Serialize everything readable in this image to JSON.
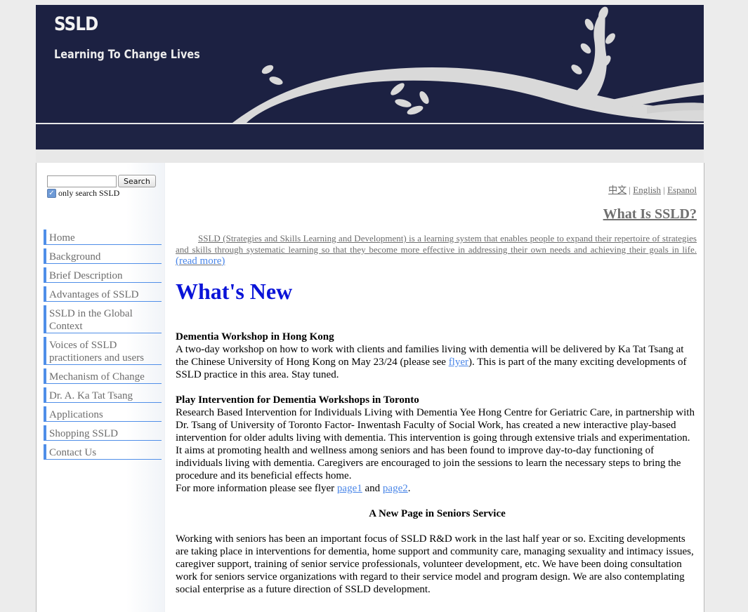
{
  "header": {
    "title": "SSLD",
    "tagline": "Learning To Change Lives"
  },
  "search": {
    "button_label": "Search",
    "input_value": "",
    "only_label": "only search SSLD",
    "only_checked": true
  },
  "nav": {
    "items": [
      "Home",
      "Background",
      "Brief Description",
      "Advantages of SSLD",
      "SSLD in the Global Context",
      "Voices of SSLD practitioners and users",
      "Mechanism of Change",
      "Dr. A. Ka Tat Tsang",
      "Applications",
      "Shopping SSLD",
      "Contact Us"
    ]
  },
  "languages": {
    "chinese": "中文",
    "sep": "|",
    "english": "English",
    "spanish": "Espanol"
  },
  "what_is": {
    "heading": "What Is SSLD?",
    "text": "SSLD (Strategies and Skills Learning and Development) is a learning system that enables people to expand their repertoire of strategies and skills through systematic learning so that they become more effective in addressing their own needs and achieving their goals in life.",
    "read_more": "(read more)"
  },
  "whats_new": {
    "heading": "What's New",
    "news1": {
      "title": "Dementia Workshop in Hong Kong",
      "text_before": "A two-day workshop on how to work with clients and families living with dementia will be delivered by Ka Tat Tsang at the Chinese University of Hong Kong on May 23/24 (please see ",
      "link": "flyer",
      "text_after": "). This is part of the many exciting developments of SSLD practice in this area. Stay tuned."
    },
    "news2": {
      "title": "Play Intervention for Dementia Workshops in Toronto",
      "text": "Research Based Intervention for Individuals Living with Dementia Yee Hong Centre for Geriatric Care, in partnership with Dr. Tsang of University of Toronto Factor- Inwentash Faculty of Social Work, has created a new interactive play-based intervention for older adults living with dementia. This intervention is going through extensive trials and experimentation. It aims at promoting health and wellness among seniors and has been found to improve day-to-day functioning of individuals living with dementia. Caregivers are encouraged to join the sessions to learn the necessary steps to bring the procedure and its beneficial effects home.",
      "more_prefix": "For more information please see flyer ",
      "link1": "page1",
      "and": " and ",
      "link2": "page2",
      "period": "."
    },
    "news3": {
      "title": "A New Page in Seniors Service",
      "text": "Working with seniors has been an important focus of SSLD R&D work in the last half year or so. Exciting developments are taking place in interventions for dementia, home support and community care, managing sexuality and intimacy issues, caregiver support, training of senior service professionals, volunteer development, etc. We have been doing consultation work for seniors service organizations with regard to their service model and program design. We are also contemplating social enterprise as a future direction of SSLD development."
    }
  },
  "colors": {
    "header_bg": "#1c2142",
    "nav_accent": "#4f8ee8",
    "whats_new": "#0a14d8",
    "link": "#4a86e8"
  }
}
